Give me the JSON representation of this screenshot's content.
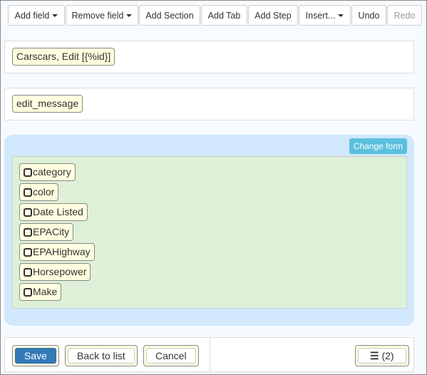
{
  "toolbar": {
    "add_field": "Add field",
    "remove_field": "Remove field",
    "add_section": "Add Section",
    "add_tab": "Add Tab",
    "add_step": "Add Step",
    "insert": "Insert...",
    "undo": "Undo",
    "redo": "Redo"
  },
  "title_chip": "Carscars, Edit [{%id}]",
  "message_chip": "edit_message",
  "change_form": "Change form",
  "fields": [
    "category",
    "color",
    "Date Listed",
    "EPACity",
    "EPAHighway",
    "Horsepower",
    "Make"
  ],
  "footer": {
    "save": "Save",
    "back": "Back to list",
    "cancel": "Cancel",
    "menu_count": "(2)"
  },
  "colors": {
    "primary": "#337ab7",
    "info": "#5bc0de",
    "section_bg": "#d1e8fd",
    "fields_bg": "#dff0d8",
    "chip_bg": "#ffffe0"
  }
}
